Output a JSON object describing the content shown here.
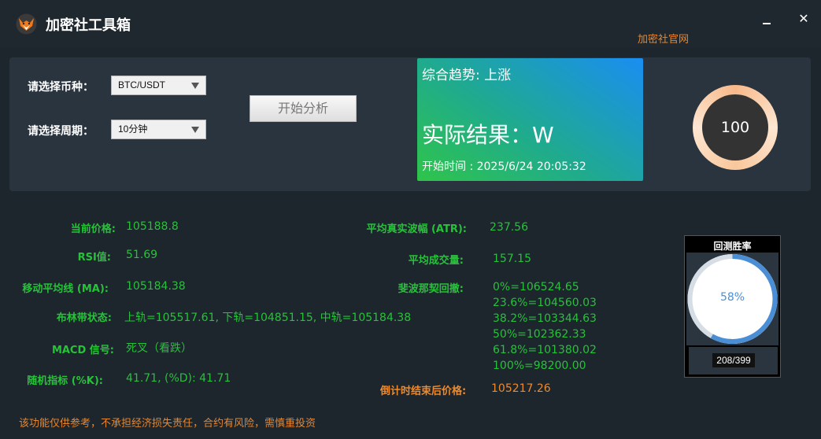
{
  "titlebar": {
    "title": "加密社工具箱",
    "logo_icon": "fox-logo-icon",
    "minimize_icon": "minimize-icon",
    "close_label": "✕",
    "official_link": "加密社官网"
  },
  "controls": {
    "coin_label": "请选择币种：",
    "coin_value": "BTC/USDT",
    "period_label": "请选择周期：",
    "period_value": "10分钟",
    "start_button": "开始分析"
  },
  "result": {
    "trend": "综合趋势: 上涨",
    "actual": "实际结果：W",
    "start_time": "开始时间 : 2025/6/24 20:05:32"
  },
  "score": {
    "value": "100"
  },
  "indicators": {
    "price_label": "当前价格:",
    "price_value": "105188.8",
    "rsi_label": "RSI值:",
    "rsi_value": "51.69",
    "ma_label": "移动平均线 (MA):",
    "ma_value": "105184.38",
    "boll_label": "布林带状态:",
    "boll_value": "上轨=105517.61, 下轨=104851.15, 中轨=105184.38",
    "macd_label": "MACD 信号:",
    "macd_value": "死叉（看跌）",
    "kd_label": "随机指标 (%K):",
    "kd_value": "41.71, (%D): 41.71",
    "atr_label": "平均真实波幅 (ATR):",
    "atr_value": "237.56",
    "vol_label": "平均成交量:",
    "vol_value": "157.15",
    "fib_label": "斐波那契回撤:",
    "fib_values": [
      "0%=106524.65",
      "23.6%=104560.03",
      "38.2%=103344.63",
      "50%=102362.33",
      "61.8%=101380.02",
      "100%=98200.00"
    ],
    "final_label": "倒计时结束后价格:",
    "final_value": "105217.26"
  },
  "winrate": {
    "title": "回测胜率",
    "percent_text": "58%",
    "fraction": 0.58,
    "count": "208/399",
    "color": "#4a8fd6"
  },
  "colors": {
    "green": "#27c23a",
    "orange": "#ef8a2a",
    "background": "#1d252d"
  },
  "disclaimer": "该功能仅供参考，不承担经济损失责任，合约有风险，需慎重投资"
}
